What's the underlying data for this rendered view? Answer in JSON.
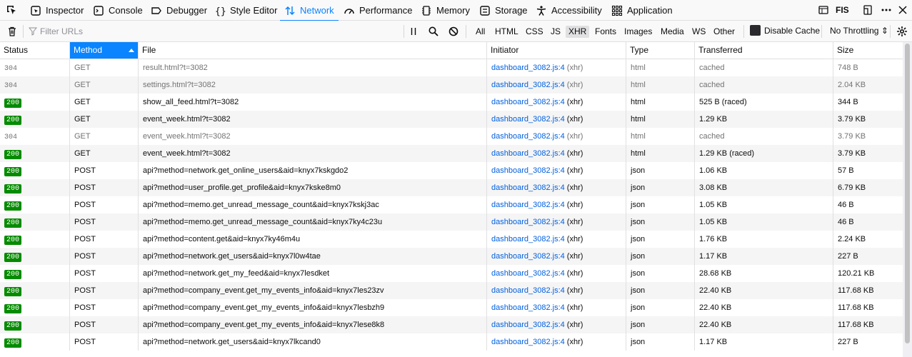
{
  "tabs": [
    {
      "label": "Inspector",
      "icon": "inspector-icon"
    },
    {
      "label": "Console",
      "icon": "console-icon"
    },
    {
      "label": "Debugger",
      "icon": "debugger-icon"
    },
    {
      "label": "Style Editor",
      "icon": "style-editor-icon"
    },
    {
      "label": "Network",
      "icon": "network-icon",
      "active": true
    },
    {
      "label": "Performance",
      "icon": "performance-icon"
    },
    {
      "label": "Memory",
      "icon": "memory-icon"
    },
    {
      "label": "Storage",
      "icon": "storage-icon"
    },
    {
      "label": "Accessibility",
      "icon": "accessibility-icon"
    },
    {
      "label": "Application",
      "icon": "application-icon"
    }
  ],
  "topright": {
    "fis_label": "FIS"
  },
  "toolbar": {
    "filter_placeholder": "Filter URLs",
    "type_filters": [
      "All",
      "HTML",
      "CSS",
      "JS",
      "XHR",
      "Fonts",
      "Images",
      "Media",
      "WS",
      "Other"
    ],
    "active_filter": "XHR",
    "disable_cache_label": "Disable Cache",
    "throttling_label": "No Throttling ⇕"
  },
  "columns": [
    "Status",
    "Method",
    "File",
    "Initiator",
    "Type",
    "Transferred",
    "Size"
  ],
  "sorted_column": "Method",
  "colors": {
    "accent": "#0a84ff",
    "status_ok": "#058b00",
    "link": "#0060df"
  },
  "rows": [
    {
      "status": "304",
      "method": "GET",
      "file": "result.html?t=3082",
      "initiator": "dashboard_3082.js:4",
      "initiator_suffix": " (xhr)",
      "type": "html",
      "transferred": "cached",
      "size": "748 B"
    },
    {
      "status": "304",
      "method": "GET",
      "file": "settings.html?t=3082",
      "initiator": "dashboard_3082.js:4",
      "initiator_suffix": " (xhr)",
      "type": "html",
      "transferred": "cached",
      "size": "2.04 KB"
    },
    {
      "status": "200",
      "method": "GET",
      "file": "show_all_feed.html?t=3082",
      "initiator": "dashboard_3082.js:4",
      "initiator_suffix": " (xhr)",
      "type": "html",
      "transferred": "525 B (raced)",
      "size": "344 B"
    },
    {
      "status": "200",
      "method": "GET",
      "file": "event_week.html?t=3082",
      "initiator": "dashboard_3082.js:4",
      "initiator_suffix": " (xhr)",
      "type": "html",
      "transferred": "1.29 KB",
      "size": "3.79 KB"
    },
    {
      "status": "304",
      "method": "GET",
      "file": "event_week.html?t=3082",
      "initiator": "dashboard_3082.js:4",
      "initiator_suffix": " (xhr)",
      "type": "html",
      "transferred": "cached",
      "size": "3.79 KB"
    },
    {
      "status": "200",
      "method": "GET",
      "file": "event_week.html?t=3082",
      "initiator": "dashboard_3082.js:4",
      "initiator_suffix": " (xhr)",
      "type": "html",
      "transferred": "1.29 KB (raced)",
      "size": "3.79 KB"
    },
    {
      "status": "200",
      "method": "POST",
      "file": "api?method=network.get_online_users&aid=knyx7kskgdo2",
      "initiator": "dashboard_3082.js:4",
      "initiator_suffix": " (xhr)",
      "type": "json",
      "transferred": "1.06 KB",
      "size": "57 B"
    },
    {
      "status": "200",
      "method": "POST",
      "file": "api?method=user_profile.get_profile&aid=knyx7kske8m0",
      "initiator": "dashboard_3082.js:4",
      "initiator_suffix": " (xhr)",
      "type": "json",
      "transferred": "3.08 KB",
      "size": "6.79 KB"
    },
    {
      "status": "200",
      "method": "POST",
      "file": "api?method=memo.get_unread_message_count&aid=knyx7kskj3ac",
      "initiator": "dashboard_3082.js:4",
      "initiator_suffix": " (xhr)",
      "type": "json",
      "transferred": "1.05 KB",
      "size": "46 B"
    },
    {
      "status": "200",
      "method": "POST",
      "file": "api?method=memo.get_unread_message_count&aid=knyx7ky4c23u",
      "initiator": "dashboard_3082.js:4",
      "initiator_suffix": " (xhr)",
      "type": "json",
      "transferred": "1.05 KB",
      "size": "46 B"
    },
    {
      "status": "200",
      "method": "POST",
      "file": "api?method=content.get&aid=knyx7ky46m4u",
      "initiator": "dashboard_3082.js:4",
      "initiator_suffix": " (xhr)",
      "type": "json",
      "transferred": "1.76 KB",
      "size": "2.24 KB"
    },
    {
      "status": "200",
      "method": "POST",
      "file": "api?method=network.get_users&aid=knyx7l0w4tae",
      "initiator": "dashboard_3082.js:4",
      "initiator_suffix": " (xhr)",
      "type": "json",
      "transferred": "1.17 KB",
      "size": "227 B"
    },
    {
      "status": "200",
      "method": "POST",
      "file": "api?method=network.get_my_feed&aid=knyx7lesdket",
      "initiator": "dashboard_3082.js:4",
      "initiator_suffix": " (xhr)",
      "type": "json",
      "transferred": "28.68 KB",
      "size": "120.21 KB"
    },
    {
      "status": "200",
      "method": "POST",
      "file": "api?method=company_event.get_my_events_info&aid=knyx7les23zv",
      "initiator": "dashboard_3082.js:4",
      "initiator_suffix": " (xhr)",
      "type": "json",
      "transferred": "22.40 KB",
      "size": "117.68 KB"
    },
    {
      "status": "200",
      "method": "POST",
      "file": "api?method=company_event.get_my_events_info&aid=knyx7lesbzh9",
      "initiator": "dashboard_3082.js:4",
      "initiator_suffix": " (xhr)",
      "type": "json",
      "transferred": "22.40 KB",
      "size": "117.68 KB"
    },
    {
      "status": "200",
      "method": "POST",
      "file": "api?method=company_event.get_my_events_info&aid=knyx7lese8k8",
      "initiator": "dashboard_3082.js:4",
      "initiator_suffix": " (xhr)",
      "type": "json",
      "transferred": "22.40 KB",
      "size": "117.68 KB"
    },
    {
      "status": "200",
      "method": "POST",
      "file": "api?method=network.get_users&aid=knyx7lkcand0",
      "initiator": "dashboard_3082.js:4",
      "initiator_suffix": " (xhr)",
      "type": "json",
      "transferred": "1.17 KB",
      "size": "227 B"
    }
  ]
}
